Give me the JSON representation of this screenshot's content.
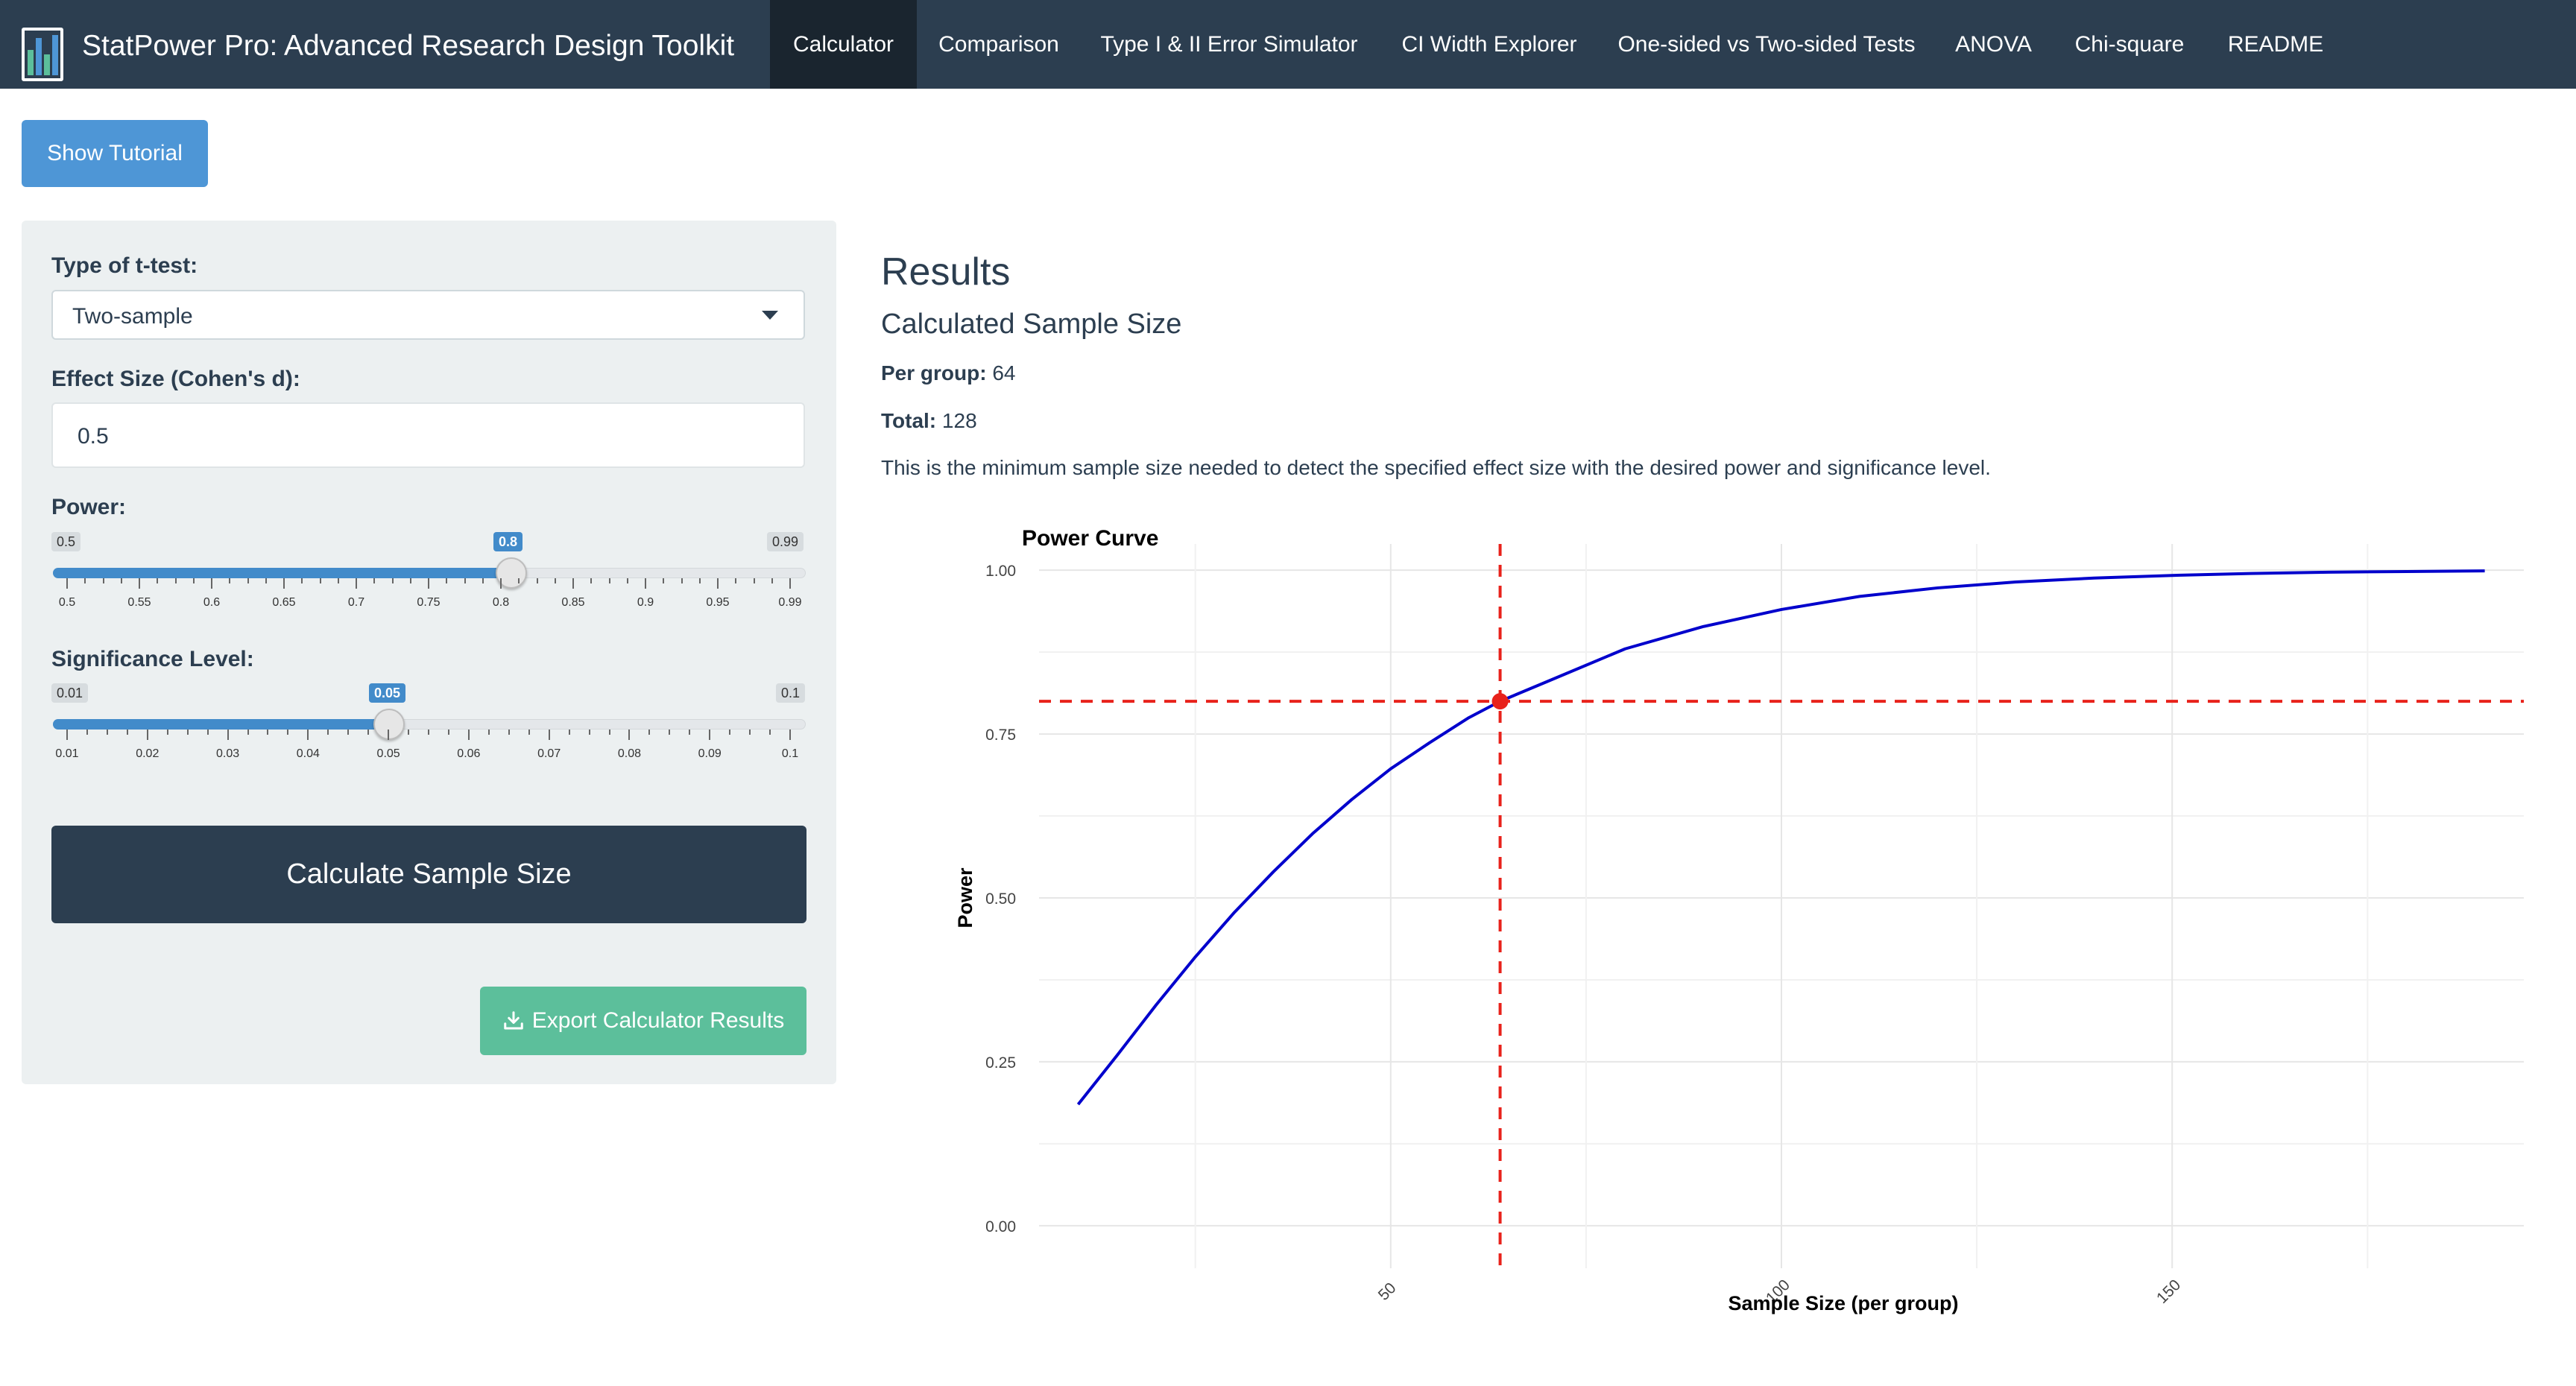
{
  "app": {
    "title": "StatPower Pro: Advanced Research Design Toolkit",
    "logo_icon": "bar-chart-logo-icon"
  },
  "nav": {
    "tabs": [
      {
        "label": "Calculator",
        "active": true
      },
      {
        "label": "Comparison",
        "active": false
      },
      {
        "label": "Type I & II Error Simulator",
        "active": false
      },
      {
        "label": "CI Width Explorer",
        "active": false
      },
      {
        "label": "One-sided vs Two-sided Tests",
        "active": false
      },
      {
        "label": "ANOVA",
        "active": false
      },
      {
        "label": "Chi-square",
        "active": false
      },
      {
        "label": "README",
        "active": false
      }
    ]
  },
  "tutorial_button": "Show Tutorial",
  "sidebar": {
    "test_type_label": "Type of t-test:",
    "test_type_value": "Two-sample",
    "effect_size_label": "Effect Size (Cohen's d):",
    "effect_size_value": "0.5",
    "power": {
      "label": "Power:",
      "min": "0.5",
      "max": "0.99",
      "value": "0.8",
      "ticks": [
        "0.5",
        "0.55",
        "0.6",
        "0.65",
        "0.7",
        "0.75",
        "0.8",
        "0.85",
        "0.9",
        "0.95",
        "0.99"
      ]
    },
    "alpha": {
      "label": "Significance Level:",
      "min": "0.01",
      "max": "0.1",
      "value": "0.05",
      "ticks": [
        "0.01",
        "0.02",
        "0.03",
        "0.04",
        "0.05",
        "0.06",
        "0.07",
        "0.08",
        "0.09",
        "0.1"
      ]
    },
    "calculate_button": "Calculate Sample Size",
    "export_button": "Export Calculator Results"
  },
  "results": {
    "title": "Results",
    "subtitle": "Calculated Sample Size",
    "per_group_label": "Per group:",
    "per_group_value": "64",
    "total_label": "Total:",
    "total_value": "128",
    "description": "This is the minimum sample size needed to detect the specified effect size with the desired power and significance level."
  },
  "chart_data": {
    "type": "line",
    "title": "Power Curve",
    "xlabel": "Sample Size (per group)",
    "ylabel": "Power",
    "xlim": [
      5,
      195
    ],
    "ylim": [
      -0.04,
      1.04
    ],
    "xticks": [
      "50",
      "100",
      "150"
    ],
    "yticks": [
      "0.00",
      "0.25",
      "0.50",
      "0.75",
      "1.00"
    ],
    "grid": true,
    "series": [
      {
        "color": "#0000cc",
        "x": [
          10,
          15,
          20,
          25,
          30,
          35,
          40,
          45,
          50,
          55,
          60,
          64,
          70,
          80,
          90,
          100,
          110,
          120,
          130,
          140,
          150,
          160,
          170,
          180,
          190
        ],
        "y": [
          0.185,
          0.26,
          0.337,
          0.41,
          0.478,
          0.54,
          0.598,
          0.65,
          0.697,
          0.737,
          0.775,
          0.8,
          0.83,
          0.88,
          0.914,
          0.94,
          0.96,
          0.973,
          0.982,
          0.988,
          0.992,
          0.995,
          0.997,
          0.998,
          0.999
        ]
      }
    ],
    "reference_lines": {
      "x": 64,
      "y": 0.8,
      "color": "#e8221b"
    },
    "highlight_point": {
      "x": 64,
      "y": 0.8,
      "color": "#e8221b"
    }
  }
}
